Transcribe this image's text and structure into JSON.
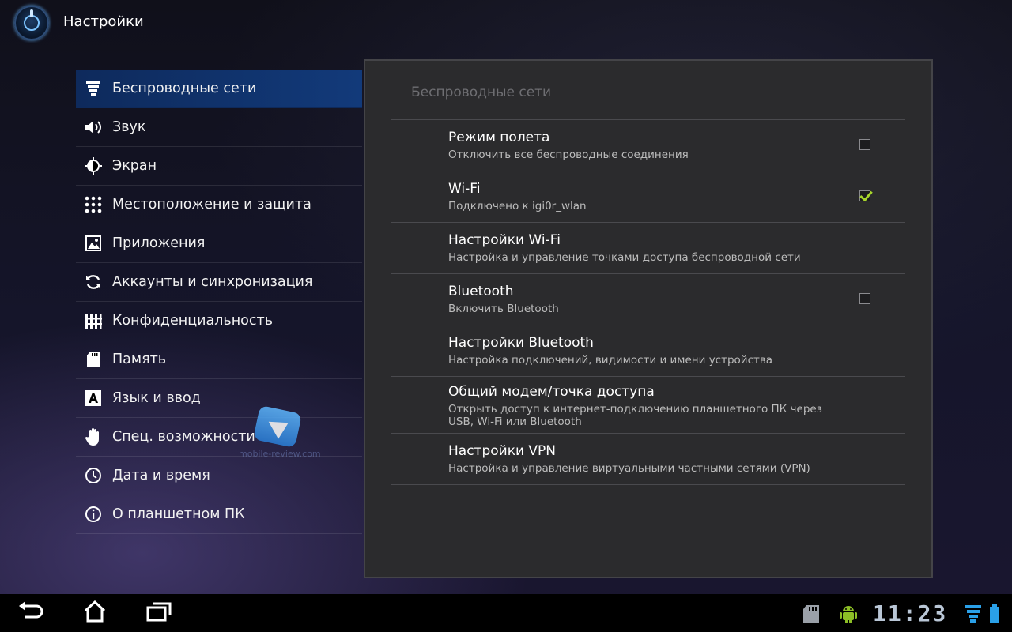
{
  "app": {
    "title": "Настройки",
    "icon": "settings-app-icon"
  },
  "categories": [
    {
      "label": "Беспроводные сети",
      "icon": "wireless-signal-icon",
      "selected": true
    },
    {
      "label": "Звук",
      "icon": "speaker-icon",
      "selected": false
    },
    {
      "label": "Экран",
      "icon": "brightness-icon",
      "selected": false
    },
    {
      "label": "Местоположение и защита",
      "icon": "location-grid-icon",
      "selected": false
    },
    {
      "label": "Приложения",
      "icon": "apps-icon",
      "selected": false
    },
    {
      "label": "Аккаунты и синхронизация",
      "icon": "sync-icon",
      "selected": false
    },
    {
      "label": "Конфиденциальность",
      "icon": "privacy-fence-icon",
      "selected": false
    },
    {
      "label": "Память",
      "icon": "sd-card-icon",
      "selected": false
    },
    {
      "label": "Язык и ввод",
      "icon": "language-icon",
      "selected": false
    },
    {
      "label": "Спец. возможности",
      "icon": "hand-icon",
      "selected": false
    },
    {
      "label": "Дата и время",
      "icon": "clock-icon",
      "selected": false
    },
    {
      "label": "О планшетном ПК",
      "icon": "info-icon",
      "selected": false
    }
  ],
  "panel": {
    "header": "Беспроводные сети",
    "items": [
      {
        "title": "Режим полета",
        "summary": "Отключить все беспроводные соединения",
        "checkbox": true,
        "checked": false
      },
      {
        "title": "Wi-Fi",
        "summary": "Подключено к igi0r_wlan",
        "checkbox": true,
        "checked": true
      },
      {
        "title": "Настройки Wi-Fi",
        "summary": "Настройка и управление точками доступа беспроводной сети",
        "checkbox": false
      },
      {
        "title": "Bluetooth",
        "summary": "Включить Bluetooth",
        "checkbox": true,
        "checked": false
      },
      {
        "title": "Настройки Bluetooth",
        "summary": "Настройка подключений, видимости и имени устройства",
        "checkbox": false
      },
      {
        "title": "Общий модем/точка доступа",
        "summary": "Открыть доступ к интернет-подключению планшетного ПК через USB, Wi-Fi или Bluetooth",
        "checkbox": false
      },
      {
        "title": "Настройки VPN",
        "summary": "Настройка и управление виртуальными частными сетями (VPN)",
        "checkbox": false
      }
    ]
  },
  "watermark": {
    "text": "mobile-review.com",
    "icon": "mobile-review-logo-icon"
  },
  "system_bar": {
    "clock": "11:23",
    "buttons": [
      "back-icon",
      "home-icon",
      "recent-apps-icon"
    ],
    "status_icons": [
      "sd-card-status-icon",
      "android-debug-icon",
      "wifi-status-icon",
      "battery-icon"
    ]
  },
  "colors": {
    "accent_selected": "#123a7a",
    "check": "#a8d62b",
    "panel_bg": "#2b2b2d"
  }
}
